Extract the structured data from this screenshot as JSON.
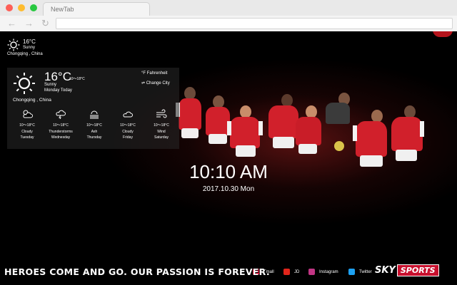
{
  "browser": {
    "tab_title": "NewTab",
    "back_glyph": "←",
    "forward_glyph": "→",
    "reload_glyph": "↻"
  },
  "mini_weather": {
    "temp": "16°C",
    "condition": "Sunny",
    "city": "Chongqing , China",
    "icon": "sun-icon"
  },
  "weather": {
    "temp": "16°C",
    "range": "10～18°C",
    "condition": "Sunny",
    "day_label": "Monday Today",
    "unit_link": "°F  Fahrenheit",
    "city_link": "⇌  Change City",
    "city": "Chongqing , China",
    "forecast": [
      {
        "icon": "partly-cloudy-icon",
        "range": "10～18°C",
        "condition": "Cloudy",
        "day": "Tuesday"
      },
      {
        "icon": "thunderstorm-icon",
        "range": "10～18°C",
        "condition": "Thunderstorms",
        "day": "Wednesday"
      },
      {
        "icon": "ash-icon",
        "range": "10～18°C",
        "condition": "Ash",
        "day": "Thursday"
      },
      {
        "icon": "cloud-icon",
        "range": "10～18°C",
        "condition": "Cloudy",
        "day": "Friday"
      },
      {
        "icon": "wind-icon",
        "range": "10～18°C",
        "condition": "Wind",
        "day": "Saturday"
      }
    ]
  },
  "clock": {
    "time": "10:10 AM",
    "date": "2017.10.30 Mon"
  },
  "tagline": "HEROES COME AND GO. OUR PASSION IS FOREVER.",
  "quick_links": [
    {
      "label": "Tmall",
      "color": "#e4002b"
    },
    {
      "label": "JD",
      "color": "#e1251b"
    },
    {
      "label": "Instagram",
      "color": "#c13584"
    },
    {
      "label": "Twitter",
      "color": "#1da1f2"
    }
  ],
  "brand": {
    "sky": "SKY",
    "sports": "SPORTS"
  },
  "colors": {
    "arsenal_red": "#d1202b",
    "sky_red": "#c8102e"
  }
}
